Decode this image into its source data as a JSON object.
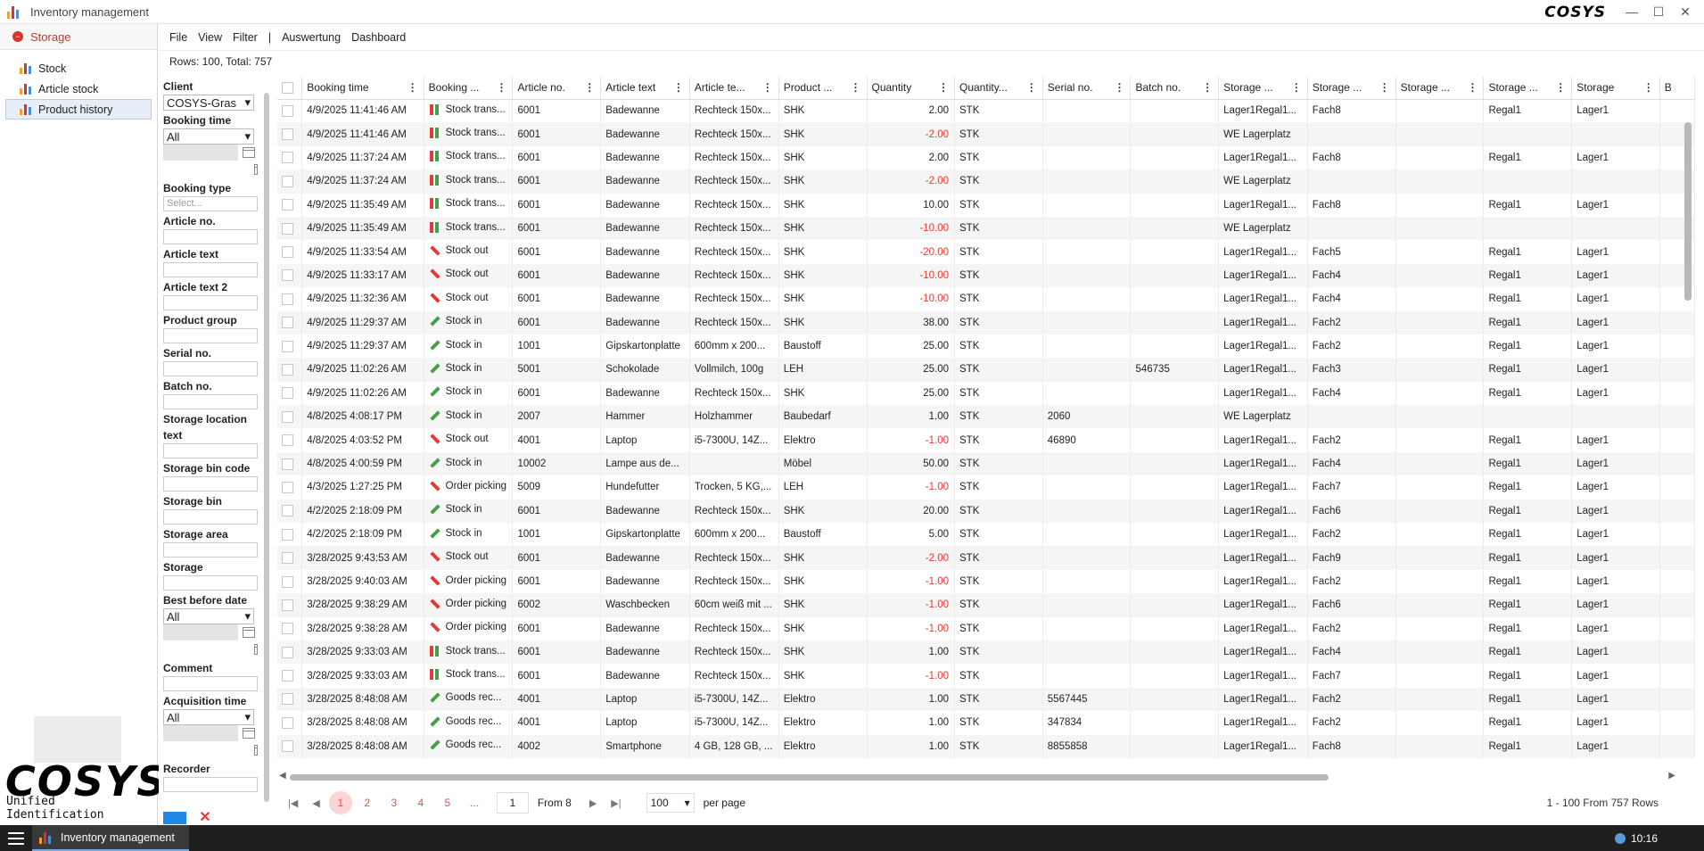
{
  "window": {
    "title": "Inventory management",
    "brand": "COSYS"
  },
  "sidebar": {
    "header": "Storage",
    "items": [
      {
        "label": "Stock"
      },
      {
        "label": "Article stock"
      },
      {
        "label": "Product history"
      }
    ],
    "logo": "COSYS",
    "tagline": "Unified Identification"
  },
  "menu": {
    "file": "File",
    "view": "View",
    "filter": "Filter",
    "sep": "|",
    "auswertung": "Auswertung",
    "dashboard": "Dashboard"
  },
  "rows_info": "Rows: 100, Total: 757",
  "filters": {
    "client": {
      "label": "Client",
      "value": "COSYS-Gras"
    },
    "booking_time": {
      "label": "Booking time",
      "value": "All"
    },
    "booking_type": {
      "label": "Booking type",
      "placeholder": "Select..."
    },
    "article_no": "Article no.",
    "article_text": "Article text",
    "article_text2": "Article text 2",
    "product_group": "Product group",
    "serial_no": "Serial no.",
    "batch_no": "Batch no.",
    "storage_location_text": "Storage location text",
    "storage_bin_code": "Storage bin code",
    "storage_bin": "Storage bin",
    "storage_area": "Storage area",
    "storage": "Storage",
    "best_before_date": {
      "label": "Best before date",
      "value": "All"
    },
    "comment": "Comment",
    "acquisition_time": {
      "label": "Acquisition time",
      "value": "All"
    },
    "recorder": "Recorder"
  },
  "columns": [
    "Booking time",
    "Booking ...",
    "Article no.",
    "Article text",
    "Article te...",
    "Product ...",
    "Quantity",
    "Quantity...",
    "Serial no.",
    "Batch no.",
    "Storage ...",
    "Storage ...",
    "Storage ...",
    "Storage ...",
    "Storage",
    "B"
  ],
  "rows": [
    {
      "time": "4/9/2025 11:41:46 AM",
      "type": "Stock trans...",
      "kind": "trans",
      "artno": "6001",
      "art": "Badewanne",
      "art2": "Rechteck 150x...",
      "pg": "SHK",
      "qty": "2.00",
      "neg": false,
      "unit": "STK",
      "serial": "",
      "batch": "",
      "s1": "Lager1Regal1...",
      "s2": "Fach8",
      "s3": "",
      "s4": "Regal1",
      "s5": "Lager1"
    },
    {
      "time": "4/9/2025 11:41:46 AM",
      "type": "Stock trans...",
      "kind": "trans",
      "artno": "6001",
      "art": "Badewanne",
      "art2": "Rechteck 150x...",
      "pg": "SHK",
      "qty": "-2.00",
      "neg": true,
      "unit": "STK",
      "serial": "",
      "batch": "",
      "s1": "WE Lagerplatz",
      "s2": "",
      "s3": "",
      "s4": "",
      "s5": ""
    },
    {
      "time": "4/9/2025 11:37:24 AM",
      "type": "Stock trans...",
      "kind": "trans",
      "artno": "6001",
      "art": "Badewanne",
      "art2": "Rechteck 150x...",
      "pg": "SHK",
      "qty": "2.00",
      "neg": false,
      "unit": "STK",
      "serial": "",
      "batch": "",
      "s1": "Lager1Regal1...",
      "s2": "Fach8",
      "s3": "",
      "s4": "Regal1",
      "s5": "Lager1"
    },
    {
      "time": "4/9/2025 11:37:24 AM",
      "type": "Stock trans...",
      "kind": "trans",
      "artno": "6001",
      "art": "Badewanne",
      "art2": "Rechteck 150x...",
      "pg": "SHK",
      "qty": "-2.00",
      "neg": true,
      "unit": "STK",
      "serial": "",
      "batch": "",
      "s1": "WE Lagerplatz",
      "s2": "",
      "s3": "",
      "s4": "",
      "s5": ""
    },
    {
      "time": "4/9/2025 11:35:49 AM",
      "type": "Stock trans...",
      "kind": "trans",
      "artno": "6001",
      "art": "Badewanne",
      "art2": "Rechteck 150x...",
      "pg": "SHK",
      "qty": "10.00",
      "neg": false,
      "unit": "STK",
      "serial": "",
      "batch": "",
      "s1": "Lager1Regal1...",
      "s2": "Fach8",
      "s3": "",
      "s4": "Regal1",
      "s5": "Lager1"
    },
    {
      "time": "4/9/2025 11:35:49 AM",
      "type": "Stock trans...",
      "kind": "trans",
      "artno": "6001",
      "art": "Badewanne",
      "art2": "Rechteck 150x...",
      "pg": "SHK",
      "qty": "-10.00",
      "neg": true,
      "unit": "STK",
      "serial": "",
      "batch": "",
      "s1": "WE Lagerplatz",
      "s2": "",
      "s3": "",
      "s4": "",
      "s5": ""
    },
    {
      "time": "4/9/2025 11:33:54 AM",
      "type": "Stock out",
      "kind": "out",
      "artno": "6001",
      "art": "Badewanne",
      "art2": "Rechteck 150x...",
      "pg": "SHK",
      "qty": "-20.00",
      "neg": true,
      "unit": "STK",
      "serial": "",
      "batch": "",
      "s1": "Lager1Regal1...",
      "s2": "Fach5",
      "s3": "",
      "s4": "Regal1",
      "s5": "Lager1"
    },
    {
      "time": "4/9/2025 11:33:17 AM",
      "type": "Stock out",
      "kind": "out",
      "artno": "6001",
      "art": "Badewanne",
      "art2": "Rechteck 150x...",
      "pg": "SHK",
      "qty": "-10.00",
      "neg": true,
      "unit": "STK",
      "serial": "",
      "batch": "",
      "s1": "Lager1Regal1...",
      "s2": "Fach4",
      "s3": "",
      "s4": "Regal1",
      "s5": "Lager1"
    },
    {
      "time": "4/9/2025 11:32:36 AM",
      "type": "Stock out",
      "kind": "out",
      "artno": "6001",
      "art": "Badewanne",
      "art2": "Rechteck 150x...",
      "pg": "SHK",
      "qty": "-10.00",
      "neg": true,
      "unit": "STK",
      "serial": "",
      "batch": "",
      "s1": "Lager1Regal1...",
      "s2": "Fach4",
      "s3": "",
      "s4": "Regal1",
      "s5": "Lager1"
    },
    {
      "time": "4/9/2025 11:29:37 AM",
      "type": "Stock in",
      "kind": "in",
      "artno": "6001",
      "art": "Badewanne",
      "art2": "Rechteck 150x...",
      "pg": "SHK",
      "qty": "38.00",
      "neg": false,
      "unit": "STK",
      "serial": "",
      "batch": "",
      "s1": "Lager1Regal1...",
      "s2": "Fach2",
      "s3": "",
      "s4": "Regal1",
      "s5": "Lager1"
    },
    {
      "time": "4/9/2025 11:29:37 AM",
      "type": "Stock in",
      "kind": "in",
      "artno": "1001",
      "art": "Gipskartonplatte",
      "art2": "600mm x 200...",
      "pg": "Baustoff",
      "qty": "25.00",
      "neg": false,
      "unit": "STK",
      "serial": "",
      "batch": "",
      "s1": "Lager1Regal1...",
      "s2": "Fach2",
      "s3": "",
      "s4": "Regal1",
      "s5": "Lager1"
    },
    {
      "time": "4/9/2025 11:02:26 AM",
      "type": "Stock in",
      "kind": "in",
      "artno": "5001",
      "art": "Schokolade",
      "art2": "Vollmilch, 100g",
      "pg": "LEH",
      "qty": "25.00",
      "neg": false,
      "unit": "STK",
      "serial": "",
      "batch": "546735",
      "s1": "Lager1Regal1...",
      "s2": "Fach3",
      "s3": "",
      "s4": "Regal1",
      "s5": "Lager1"
    },
    {
      "time": "4/9/2025 11:02:26 AM",
      "type": "Stock in",
      "kind": "in",
      "artno": "6001",
      "art": "Badewanne",
      "art2": "Rechteck 150x...",
      "pg": "SHK",
      "qty": "25.00",
      "neg": false,
      "unit": "STK",
      "serial": "",
      "batch": "",
      "s1": "Lager1Regal1...",
      "s2": "Fach4",
      "s3": "",
      "s4": "Regal1",
      "s5": "Lager1"
    },
    {
      "time": "4/8/2025 4:08:17 PM",
      "type": "Stock in",
      "kind": "in",
      "artno": "2007",
      "art": "Hammer",
      "art2": "Holzhammer",
      "pg": "Baubedarf",
      "qty": "1.00",
      "neg": false,
      "unit": "STK",
      "serial": "2060",
      "batch": "",
      "s1": "WE Lagerplatz",
      "s2": "",
      "s3": "",
      "s4": "",
      "s5": ""
    },
    {
      "time": "4/8/2025 4:03:52 PM",
      "type": "Stock out",
      "kind": "out",
      "artno": "4001",
      "art": "Laptop",
      "art2": "i5-7300U, 14Z...",
      "pg": "Elektro",
      "qty": "-1.00",
      "neg": true,
      "unit": "STK",
      "serial": "46890",
      "batch": "",
      "s1": "Lager1Regal1...",
      "s2": "Fach2",
      "s3": "",
      "s4": "Regal1",
      "s5": "Lager1"
    },
    {
      "time": "4/8/2025 4:00:59 PM",
      "type": "Stock in",
      "kind": "in",
      "artno": "10002",
      "art": "Lampe aus de...",
      "art2": "",
      "pg": "Möbel",
      "qty": "50.00",
      "neg": false,
      "unit": "STK",
      "serial": "",
      "batch": "",
      "s1": "Lager1Regal1...",
      "s2": "Fach4",
      "s3": "",
      "s4": "Regal1",
      "s5": "Lager1"
    },
    {
      "time": "4/3/2025 1:27:25 PM",
      "type": "Order picking",
      "kind": "out",
      "artno": "5009",
      "art": "Hundefutter",
      "art2": "Trocken, 5 KG,...",
      "pg": "LEH",
      "qty": "-1.00",
      "neg": true,
      "unit": "STK",
      "serial": "",
      "batch": "",
      "s1": "Lager1Regal1...",
      "s2": "Fach7",
      "s3": "",
      "s4": "Regal1",
      "s5": "Lager1"
    },
    {
      "time": "4/2/2025 2:18:09 PM",
      "type": "Stock in",
      "kind": "in",
      "artno": "6001",
      "art": "Badewanne",
      "art2": "Rechteck 150x...",
      "pg": "SHK",
      "qty": "20.00",
      "neg": false,
      "unit": "STK",
      "serial": "",
      "batch": "",
      "s1": "Lager1Regal1...",
      "s2": "Fach6",
      "s3": "",
      "s4": "Regal1",
      "s5": "Lager1"
    },
    {
      "time": "4/2/2025 2:18:09 PM",
      "type": "Stock in",
      "kind": "in",
      "artno": "1001",
      "art": "Gipskartonplatte",
      "art2": "600mm x 200...",
      "pg": "Baustoff",
      "qty": "5.00",
      "neg": false,
      "unit": "STK",
      "serial": "",
      "batch": "",
      "s1": "Lager1Regal1...",
      "s2": "Fach2",
      "s3": "",
      "s4": "Regal1",
      "s5": "Lager1"
    },
    {
      "time": "3/28/2025 9:43:53 AM",
      "type": "Stock out",
      "kind": "out",
      "artno": "6001",
      "art": "Badewanne",
      "art2": "Rechteck 150x...",
      "pg": "SHK",
      "qty": "-2.00",
      "neg": true,
      "unit": "STK",
      "serial": "",
      "batch": "",
      "s1": "Lager1Regal1...",
      "s2": "Fach9",
      "s3": "",
      "s4": "Regal1",
      "s5": "Lager1"
    },
    {
      "time": "3/28/2025 9:40:03 AM",
      "type": "Order picking",
      "kind": "out",
      "artno": "6001",
      "art": "Badewanne",
      "art2": "Rechteck 150x...",
      "pg": "SHK",
      "qty": "-1.00",
      "neg": true,
      "unit": "STK",
      "serial": "",
      "batch": "",
      "s1": "Lager1Regal1...",
      "s2": "Fach2",
      "s3": "",
      "s4": "Regal1",
      "s5": "Lager1"
    },
    {
      "time": "3/28/2025 9:38:29 AM",
      "type": "Order picking",
      "kind": "out",
      "artno": "6002",
      "art": "Waschbecken",
      "art2": "60cm weiß mit ...",
      "pg": "SHK",
      "qty": "-1.00",
      "neg": true,
      "unit": "STK",
      "serial": "",
      "batch": "",
      "s1": "Lager1Regal1...",
      "s2": "Fach6",
      "s3": "",
      "s4": "Regal1",
      "s5": "Lager1"
    },
    {
      "time": "3/28/2025 9:38:28 AM",
      "type": "Order picking",
      "kind": "out",
      "artno": "6001",
      "art": "Badewanne",
      "art2": "Rechteck 150x...",
      "pg": "SHK",
      "qty": "-1.00",
      "neg": true,
      "unit": "STK",
      "serial": "",
      "batch": "",
      "s1": "Lager1Regal1...",
      "s2": "Fach2",
      "s3": "",
      "s4": "Regal1",
      "s5": "Lager1"
    },
    {
      "time": "3/28/2025 9:33:03 AM",
      "type": "Stock trans...",
      "kind": "trans",
      "artno": "6001",
      "art": "Badewanne",
      "art2": "Rechteck 150x...",
      "pg": "SHK",
      "qty": "1.00",
      "neg": false,
      "unit": "STK",
      "serial": "",
      "batch": "",
      "s1": "Lager1Regal1...",
      "s2": "Fach4",
      "s3": "",
      "s4": "Regal1",
      "s5": "Lager1"
    },
    {
      "time": "3/28/2025 9:33:03 AM",
      "type": "Stock trans...",
      "kind": "trans",
      "artno": "6001",
      "art": "Badewanne",
      "art2": "Rechteck 150x...",
      "pg": "SHK",
      "qty": "-1.00",
      "neg": true,
      "unit": "STK",
      "serial": "",
      "batch": "",
      "s1": "Lager1Regal1...",
      "s2": "Fach7",
      "s3": "",
      "s4": "Regal1",
      "s5": "Lager1"
    },
    {
      "time": "3/28/2025 8:48:08 AM",
      "type": "Goods rec...",
      "kind": "in",
      "artno": "4001",
      "art": "Laptop",
      "art2": "i5-7300U, 14Z...",
      "pg": "Elektro",
      "qty": "1.00",
      "neg": false,
      "unit": "STK",
      "serial": "5567445",
      "batch": "",
      "s1": "Lager1Regal1...",
      "s2": "Fach2",
      "s3": "",
      "s4": "Regal1",
      "s5": "Lager1"
    },
    {
      "time": "3/28/2025 8:48:08 AM",
      "type": "Goods rec...",
      "kind": "in",
      "artno": "4001",
      "art": "Laptop",
      "art2": "i5-7300U, 14Z...",
      "pg": "Elektro",
      "qty": "1.00",
      "neg": false,
      "unit": "STK",
      "serial": "347834",
      "batch": "",
      "s1": "Lager1Regal1...",
      "s2": "Fach2",
      "s3": "",
      "s4": "Regal1",
      "s5": "Lager1"
    },
    {
      "time": "3/28/2025 8:48:08 AM",
      "type": "Goods rec...",
      "kind": "in",
      "artno": "4002",
      "art": "Smartphone",
      "art2": "4 GB, 128 GB, ...",
      "pg": "Elektro",
      "qty": "1.00",
      "neg": false,
      "unit": "STK",
      "serial": "8855858",
      "batch": "",
      "s1": "Lager1Regal1...",
      "s2": "Fach8",
      "s3": "",
      "s4": "Regal1",
      "s5": "Lager1"
    }
  ],
  "pager": {
    "pages": [
      "1",
      "2",
      "3",
      "4",
      "5"
    ],
    "ellipsis": "...",
    "current": "1",
    "from": "From 8",
    "page_size": "100",
    "per_page": "per page",
    "summary": "1 - 100 From 757 Rows"
  },
  "taskbar": {
    "app": "Inventory management",
    "clock": "10:16"
  },
  "colors": {
    "accent": "#d9342b",
    "negative": "#e53935",
    "stock_in": "#43a047",
    "selection": "#e8eef7"
  }
}
